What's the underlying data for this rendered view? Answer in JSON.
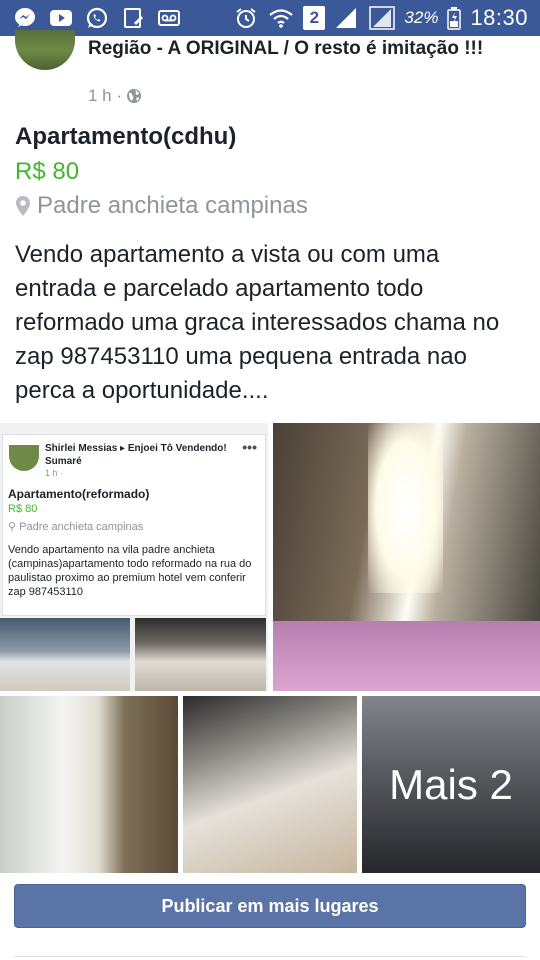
{
  "status_bar": {
    "battery_percent": "32%",
    "time": "18:30",
    "sim_indicator": "2",
    "left_icons": [
      "messenger-icon",
      "youtube-icon",
      "whatsapp-icon",
      "clipboard-icon",
      "voicemail-icon"
    ],
    "right_icons": [
      "alarm-icon",
      "wifi-icon",
      "signal-icon",
      "signal-icon",
      "battery-icon"
    ]
  },
  "post": {
    "group_name": "Região - A ORIGINAL / O resto é imitação !!!",
    "timestamp": "1 h ·"
  },
  "listing": {
    "title": "Apartamento(cdhu)",
    "price": "R$ 80",
    "location": "Padre anchieta campinas",
    "description": "Vendo apartamento a vista ou com uma entrada e parcelado apartamento todo reformado uma graca interessados chama no zap 987453110 uma pequena entrada nao perca a oportunidade...."
  },
  "inner_post": {
    "author": "Shirlei Messias ▸ Enjoei Tô Vendendo! Sumaré",
    "timestamp": "1 h ·",
    "title": "Apartamento(reformado)",
    "price": "R$ 80",
    "location": "Padre anchieta campinas",
    "description": "Vendo apartamento na vila padre anchieta (campinas)apartamento todo reformado na rua do paulistao proximo ao premium hotel vem conferir zap 987453110"
  },
  "gallery": {
    "more_label": "Mais 2"
  },
  "actions": {
    "publish_label": "Publicar em mais lugares"
  },
  "colors": {
    "status_bar": "#3b5998",
    "price": "#42b72a",
    "muted": "#90949c",
    "button": "#5b74a8"
  }
}
